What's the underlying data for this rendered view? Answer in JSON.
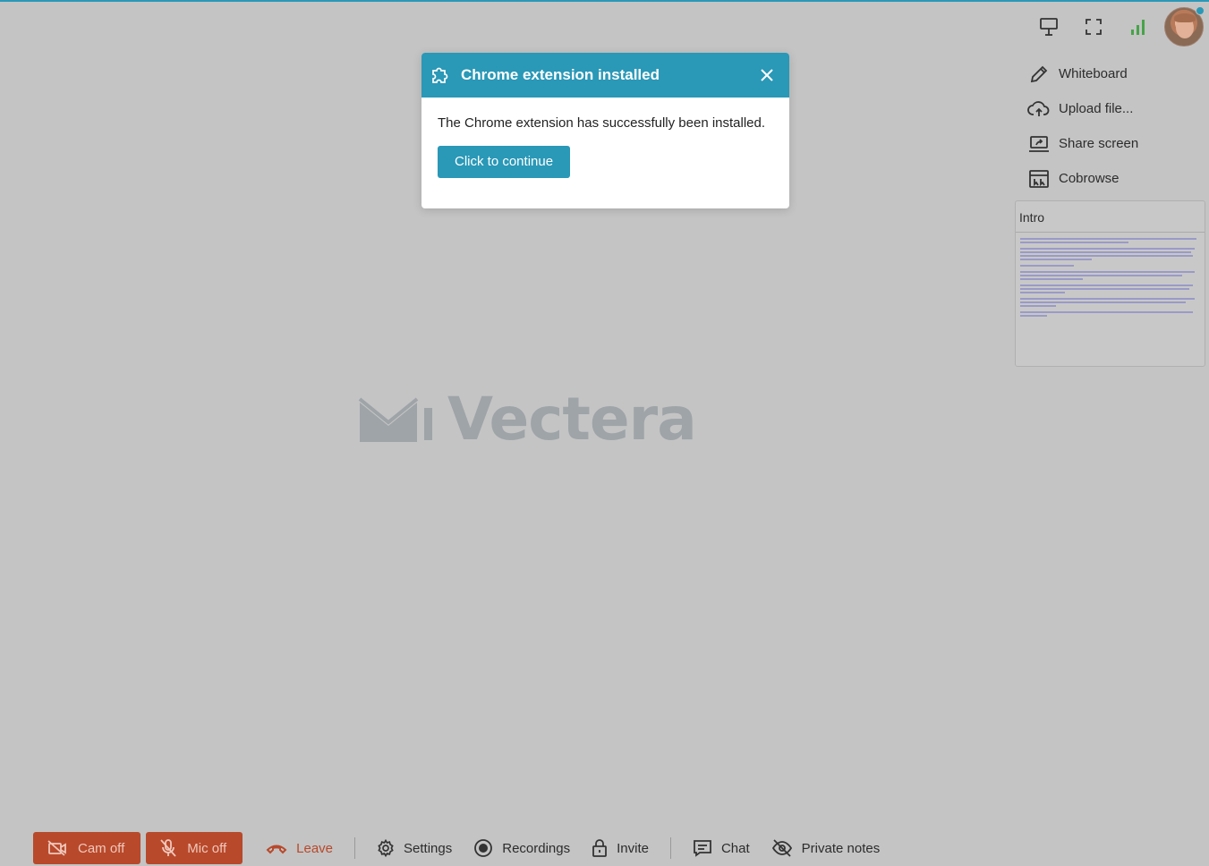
{
  "colors": {
    "accent": "#2a98b7",
    "danger": "#b8492b",
    "background": "#c4c4c4"
  },
  "top_tools": {
    "items": [
      {
        "icon": "presentation-icon"
      },
      {
        "icon": "fullscreen-icon"
      },
      {
        "icon": "signal-bars-icon"
      }
    ],
    "avatar": "user-avatar"
  },
  "side_menu": {
    "items": [
      {
        "label": "Whiteboard",
        "icon": "pencil-icon"
      },
      {
        "label": "Upload file...",
        "icon": "cloud-upload-icon"
      },
      {
        "label": "Share screen",
        "icon": "share-screen-icon"
      },
      {
        "label": "Cobrowse",
        "icon": "cobrowse-icon"
      }
    ]
  },
  "document": {
    "title": "Intro"
  },
  "logo": {
    "text": "Vectera"
  },
  "dialog": {
    "title": "Chrome extension installed",
    "message": "The Chrome extension has successfully been installed.",
    "button": "Click to continue"
  },
  "bottom_bar": {
    "cam": "Cam off",
    "mic": "Mic off",
    "leave": "Leave",
    "settings": "Settings",
    "recordings": "Recordings",
    "invite": "Invite",
    "chat": "Chat",
    "private_notes": "Private notes"
  }
}
